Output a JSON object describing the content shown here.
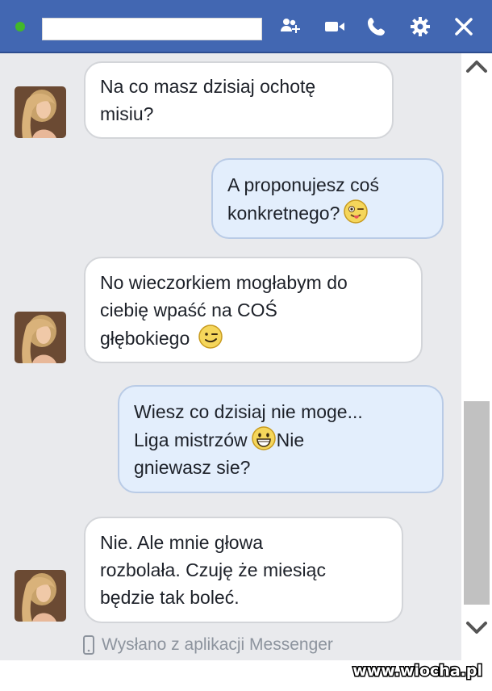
{
  "header": {
    "contact_name": "",
    "status_color": "#42b72a",
    "icons": [
      "add-people-icon",
      "video-call-icon",
      "phone-call-icon",
      "gear-icon",
      "close-icon"
    ]
  },
  "messages": [
    {
      "direction": "incoming",
      "lines": [
        "Na co masz dzisiaj ochotę",
        "misiu?"
      ],
      "emoji": null
    },
    {
      "direction": "outgoing",
      "lines": [
        "A proponujesz coś",
        "konkretnego?"
      ],
      "emoji": "tongue-wink-emoji"
    },
    {
      "direction": "incoming",
      "lines": [
        "No wieczorkiem mogłabym do",
        "ciebię wpaść na COŚ",
        "głębokiego"
      ],
      "emoji": "wink-emoji"
    },
    {
      "direction": "outgoing",
      "lines": [
        "Wiesz co dzisiaj nie moge...",
        "Liga mistrzów",
        "Nie",
        "gniewasz sie?"
      ],
      "emoji": "grin-emoji"
    },
    {
      "direction": "incoming",
      "lines": [
        "Nie. Ale mnie głowa",
        "rozbolała. Czuję że miesiąc",
        "będzie tak boleć."
      ],
      "emoji": null
    }
  ],
  "footer": {
    "sent_from": "Wysłano z aplikacji Messenger"
  },
  "watermark": "www.wiocha.pl",
  "colors": {
    "header": "#4267b2",
    "chat_background": "#e9eaed",
    "incoming_bubble": "#ffffff",
    "outgoing_bubble": "#e3eefc"
  }
}
